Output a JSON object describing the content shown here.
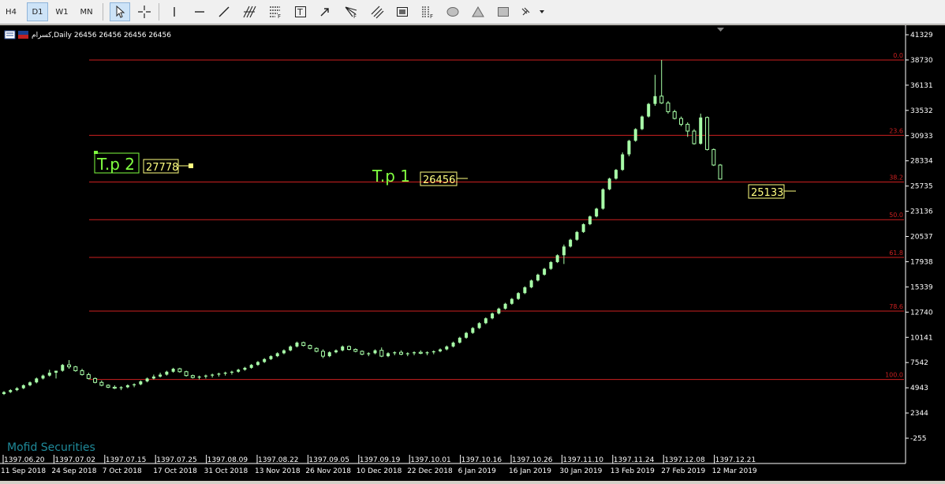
{
  "toolbar": {
    "timeframes": [
      {
        "label": "H4",
        "active": false
      },
      {
        "label": "D1",
        "active": true
      },
      {
        "label": "W1",
        "active": false
      },
      {
        "label": "MN",
        "active": false
      }
    ],
    "tools": [
      "cursor-icon",
      "crosshair-icon",
      "vertical-line-icon",
      "horizontal-line-icon",
      "trendline-icon",
      "andrews-pitchfork-icon",
      "fibonacci-retracement-icon",
      "text-label-icon",
      "arrow-icon",
      "fibonacci-fan-icon",
      "equidistant-channel-icon",
      "screenshot-icon",
      "fibonacci-timezones-icon",
      "ellipse-icon",
      "triangle-icon",
      "rectangle-icon",
      "more-tools-icon"
    ]
  },
  "chart": {
    "header": "کسرام,Daily  26456 26456 26456 26456",
    "watermark": "Mofid Securities",
    "price_ticks": [
      "41329",
      "38730",
      "36131",
      "33532",
      "30933",
      "28334",
      "25735",
      "23136",
      "20537",
      "17938",
      "15339",
      "12740",
      "10141",
      "7542",
      "4943",
      "2344",
      "-255"
    ],
    "fib_levels": [
      {
        "label": "0.0",
        "price": 38730
      },
      {
        "label": "23.6",
        "price": 30960
      },
      {
        "label": "38.2",
        "price": 26150
      },
      {
        "label": "50.0",
        "price": 22270
      },
      {
        "label": "61.8",
        "price": 18380
      },
      {
        "label": "78.6",
        "price": 12850
      },
      {
        "label": "100.0",
        "price": 5800
      }
    ],
    "annotations": {
      "tp2_label": "T.p 2",
      "tp2_value": "27778",
      "tp1_label": "T.p 1",
      "tp1_value": "26456",
      "current_value": "25133"
    },
    "time_axis": {
      "jalali": [
        "1397.06.20",
        "1397.07.02",
        "1397.07.15",
        "1397.07.25",
        "1397.08.09",
        "1397.08.22",
        "1397.09.05",
        "1397.09.19",
        "1397.10.01",
        "1397.10.16",
        "1397.10.26",
        "1397.11.10",
        "1397.11.24",
        "1397.12.08",
        "1397.12.21"
      ],
      "gregorian": [
        "11 Sep 2018",
        "24 Sep 2018",
        "7 Oct 2018",
        "17 Oct 2018",
        "31 Oct 2018",
        "13 Nov 2018",
        "26 Nov 2018",
        "10 Dec 2018",
        "22 Dec 2018",
        "6 Jan 2019",
        "16 Jan 2019",
        "30 Jan 2019",
        "13 Feb 2019",
        "27 Feb 2019",
        "12 Mar 2019"
      ]
    },
    "colors": {
      "background": "#000000",
      "candle": "#a8ffa8",
      "fib_line": "#cc2020",
      "label_yellow": "#ffff80",
      "label_green": "#80ff40",
      "text": "#ffffff",
      "watermark": "#1f8a9a"
    },
    "candles": [
      [
        4300,
        4600,
        4200,
        4500
      ],
      [
        4500,
        4800,
        4400,
        4700
      ],
      [
        4700,
        5000,
        4600,
        4900
      ],
      [
        4900,
        5300,
        4800,
        5200
      ],
      [
        5200,
        5600,
        5100,
        5500
      ],
      [
        5500,
        6000,
        5400,
        5900
      ],
      [
        5900,
        6300,
        5800,
        6200
      ],
      [
        6200,
        6800,
        6100,
        6500
      ],
      [
        6500,
        6700,
        5900,
        6700
      ],
      [
        6700,
        7400,
        6600,
        7300
      ],
      [
        7300,
        7800,
        6900,
        7100
      ],
      [
        7100,
        7200,
        6600,
        6700
      ],
      [
        6700,
        6900,
        6200,
        6300
      ],
      [
        6300,
        6500,
        5800,
        5900
      ],
      [
        5900,
        6000,
        5400,
        5500
      ],
      [
        5500,
        5700,
        5100,
        5200
      ],
      [
        5200,
        5300,
        4900,
        5000
      ],
      [
        5000,
        5200,
        4800,
        4900
      ],
      [
        4900,
        5100,
        4700,
        5000
      ],
      [
        5000,
        5300,
        4900,
        5200
      ],
      [
        5200,
        5400,
        5000,
        5300
      ],
      [
        5300,
        5700,
        5200,
        5600
      ],
      [
        5600,
        6000,
        5500,
        5900
      ],
      [
        5900,
        6300,
        5800,
        6100
      ],
      [
        6100,
        6500,
        6000,
        6300
      ],
      [
        6300,
        6700,
        6200,
        6600
      ],
      [
        6600,
        7000,
        6500,
        6900
      ],
      [
        6900,
        7000,
        6500,
        6600
      ],
      [
        6600,
        6700,
        6100,
        6200
      ],
      [
        6200,
        6300,
        5900,
        6000
      ],
      [
        6000,
        6200,
        5800,
        6100
      ],
      [
        6100,
        6300,
        5900,
        6200
      ],
      [
        6200,
        6400,
        6000,
        6300
      ],
      [
        6300,
        6500,
        6100,
        6400
      ],
      [
        6400,
        6600,
        6200,
        6500
      ],
      [
        6500,
        6700,
        6300,
        6600
      ],
      [
        6600,
        6900,
        6500,
        6800
      ],
      [
        6800,
        7100,
        6700,
        7000
      ],
      [
        7000,
        7400,
        6900,
        7300
      ],
      [
        7300,
        7700,
        7200,
        7600
      ],
      [
        7600,
        8000,
        7500,
        7900
      ],
      [
        7900,
        8300,
        7800,
        8200
      ],
      [
        8200,
        8600,
        8100,
        8500
      ],
      [
        8500,
        8900,
        8400,
        8800
      ],
      [
        8800,
        9300,
        8700,
        9200
      ],
      [
        9200,
        9700,
        9100,
        9600
      ],
      [
        9600,
        9700,
        9200,
        9300
      ],
      [
        9300,
        9400,
        8900,
        9000
      ],
      [
        9000,
        9100,
        8600,
        8700
      ],
      [
        8700,
        8900,
        8000,
        8200
      ],
      [
        8200,
        8700,
        8100,
        8600
      ],
      [
        8600,
        8900,
        8500,
        8800
      ],
      [
        8800,
        9300,
        8700,
        9200
      ],
      [
        9200,
        9300,
        8800,
        8900
      ],
      [
        8900,
        9000,
        8600,
        8700
      ],
      [
        8700,
        8800,
        8300,
        8400
      ],
      [
        8400,
        8600,
        8200,
        8500
      ],
      [
        8500,
        8900,
        8400,
        8800
      ],
      [
        8800,
        9100,
        8100,
        8200
      ],
      [
        8200,
        8600,
        8100,
        8500
      ],
      [
        8500,
        8700,
        8300,
        8600
      ],
      [
        8600,
        8800,
        8300,
        8400
      ],
      [
        8400,
        8600,
        8200,
        8500
      ],
      [
        8500,
        8700,
        8300,
        8600
      ],
      [
        8600,
        8800,
        8400,
        8500
      ],
      [
        8500,
        8700,
        8300,
        8600
      ],
      [
        8600,
        8800,
        8400,
        8700
      ],
      [
        8700,
        9000,
        8600,
        8900
      ],
      [
        8900,
        9300,
        8800,
        9200
      ],
      [
        9200,
        9700,
        9100,
        9600
      ],
      [
        9600,
        10200,
        9500,
        10100
      ],
      [
        10100,
        10700,
        10000,
        10600
      ],
      [
        10600,
        11200,
        10500,
        11100
      ],
      [
        11100,
        11700,
        11000,
        11600
      ],
      [
        11600,
        12200,
        11500,
        12100
      ],
      [
        12100,
        12700,
        12000,
        12600
      ],
      [
        12600,
        13200,
        12500,
        13100
      ],
      [
        13100,
        13700,
        13000,
        13600
      ],
      [
        13600,
        14200,
        13500,
        14100
      ],
      [
        14100,
        14800,
        14000,
        14700
      ],
      [
        14700,
        15400,
        14600,
        15300
      ],
      [
        15300,
        16100,
        15200,
        16000
      ],
      [
        16000,
        16700,
        15900,
        16600
      ],
      [
        16600,
        17300,
        16500,
        17200
      ],
      [
        17200,
        18000,
        17100,
        17900
      ],
      [
        17900,
        18700,
        17800,
        18600
      ],
      [
        18600,
        19700,
        17700,
        19500
      ],
      [
        19500,
        20300,
        19400,
        20200
      ],
      [
        20200,
        21100,
        20100,
        21000
      ],
      [
        21000,
        21900,
        20900,
        21800
      ],
      [
        21800,
        22700,
        21700,
        22600
      ],
      [
        22600,
        23500,
        22500,
        23400
      ],
      [
        23400,
        25500,
        23300,
        25400
      ],
      [
        25400,
        26600,
        25300,
        26500
      ],
      [
        26500,
        27500,
        26400,
        27400
      ],
      [
        27400,
        29200,
        27300,
        29000
      ],
      [
        29000,
        30500,
        28800,
        30400
      ],
      [
        30400,
        31700,
        30300,
        31600
      ],
      [
        31600,
        33000,
        31500,
        32900
      ],
      [
        32900,
        34300,
        32800,
        34200
      ],
      [
        34200,
        37200,
        34000,
        35000
      ],
      [
        35000,
        38730,
        34200,
        34300
      ],
      [
        34300,
        34500,
        33200,
        33400
      ],
      [
        33400,
        33600,
        32600,
        32700
      ],
      [
        32700,
        32900,
        31900,
        32100
      ],
      [
        32100,
        32300,
        30800,
        31400
      ],
      [
        31400,
        31600,
        30000,
        30100
      ],
      [
        30100,
        33200,
        30000,
        32800
      ],
      [
        32800,
        32900,
        29400,
        29500
      ],
      [
        29500,
        29600,
        27800,
        27900
      ],
      [
        27900,
        28000,
        26400,
        26456
      ]
    ]
  }
}
